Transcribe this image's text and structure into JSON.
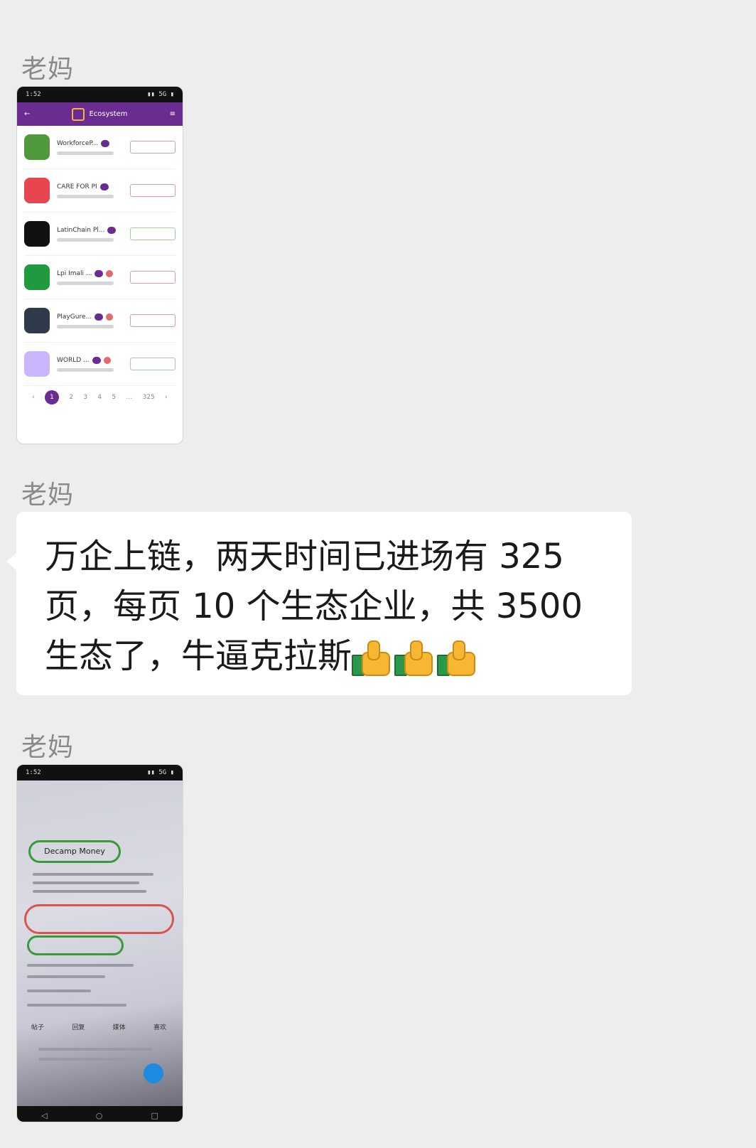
{
  "messages": [
    {
      "sender": "老妈",
      "type": "image"
    },
    {
      "sender": "老妈",
      "type": "text",
      "text_line1": "万企上链，两天时间已进场有 325",
      "text_line2": "页，每页 10 个生态企业，共 3500",
      "text_line3": "生态了，牛逼克拉斯",
      "emoji": [
        "thumbs-up-icon",
        "thumbs-up-icon",
        "thumbs-up-icon"
      ]
    },
    {
      "sender": "老妈",
      "type": "image"
    }
  ],
  "screenshot1": {
    "status_left": "1:52",
    "status_right": "▮▮ 5G ▮",
    "app_title": "Ecosystem",
    "apps": [
      {
        "name": "WorkforceP...",
        "icon_color": "#4f9a3a",
        "button_style": "red"
      },
      {
        "name": "CARE FOR PI",
        "icon_color": "#e8464f",
        "button_style": "red"
      },
      {
        "name": "LatinChain Pl...",
        "icon_color": "#111111",
        "button_style": "green"
      },
      {
        "name": "Lpi Imali ...",
        "icon_color": "#1f9a3f",
        "button_style": "red"
      },
      {
        "name": "PlayGure...",
        "icon_color": "#2f3a4a",
        "button_style": "red"
      },
      {
        "name": "WORLD ...",
        "icon_color": "#c9b6ff",
        "button_style": "green"
      }
    ],
    "pager": {
      "current": "1",
      "pages": [
        "2",
        "3",
        "4",
        "5"
      ],
      "last": "325"
    }
  },
  "screenshot2": {
    "status_left": "1:52",
    "status_right": "▮▮ 5G ▮",
    "profile_name": "Decamp Money",
    "tabs": [
      "帖子",
      "回复",
      "媒体",
      "喜欢"
    ]
  },
  "colors": {
    "background": "#ededed",
    "bubble": "#ffffff",
    "sender": "#8a8a8a",
    "pi_purple": "#6a2c91"
  }
}
